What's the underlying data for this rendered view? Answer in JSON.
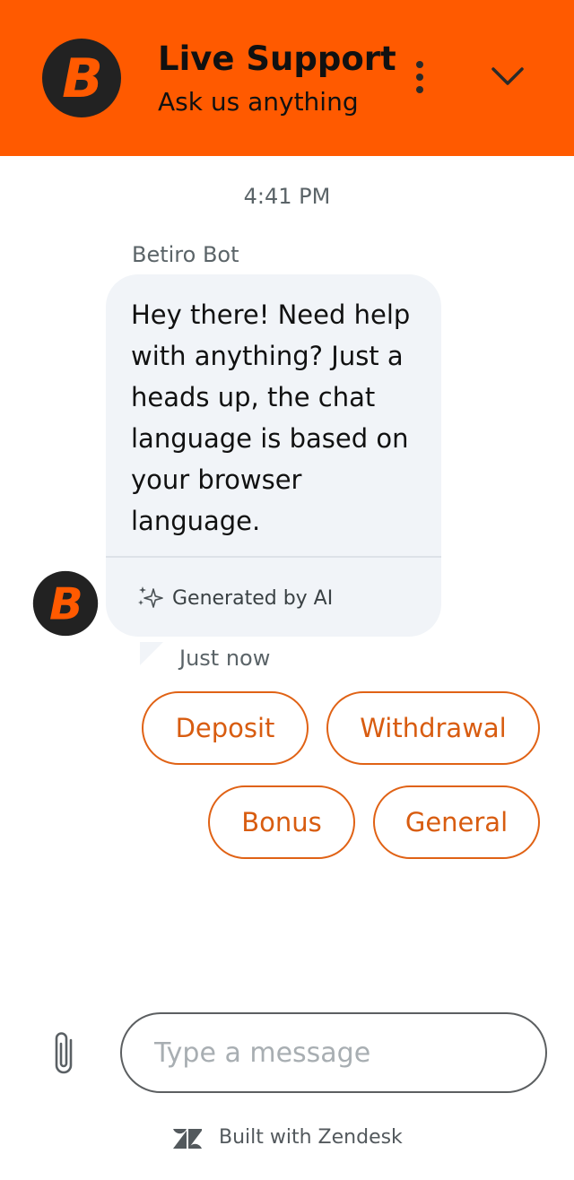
{
  "header": {
    "logo_letter": "B",
    "title": "Live Support",
    "subtitle": "Ask us anything",
    "menu_icon": "more-vertical-icon",
    "collapse_icon": "chevron-down-icon"
  },
  "conversation": {
    "timestamp": "4:41 PM",
    "messages": [
      {
        "sender": "Betiro Bot",
        "text": "Hey there! Need help with anything? Just a heads up, the chat language is based on your browser language.",
        "ai_label": "Generated by AI",
        "time": "Just now"
      }
    ],
    "quick_replies": [
      "Deposit",
      "Withdrawal",
      "Bonus",
      "General"
    ]
  },
  "composer": {
    "placeholder": "Type a message",
    "attach_icon": "paperclip-icon"
  },
  "footer": {
    "label": "Built with Zendesk",
    "icon": "zendesk-icon"
  },
  "colors": {
    "brand": "#ff5a00",
    "accent": "#e06215",
    "bubble": "#f1f4f8",
    "logo_bg": "#222222"
  }
}
